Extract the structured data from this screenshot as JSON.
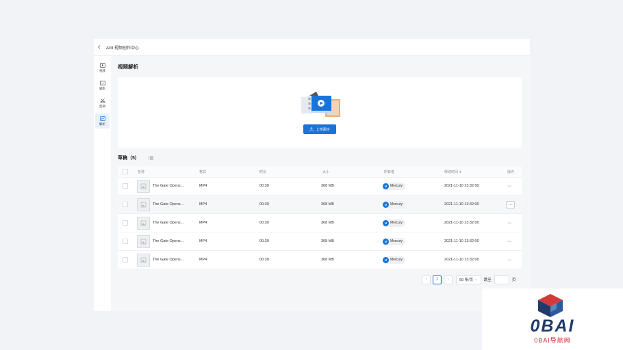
{
  "app": {
    "title": "AGI 视频创作中心"
  },
  "sidebar": {
    "items": [
      {
        "label": "视频",
        "icon": "video-icon"
      },
      {
        "label": "脚本",
        "icon": "script-icon"
      },
      {
        "label": "剪辑",
        "icon": "scissors-icon"
      },
      {
        "label": "解析",
        "icon": "analysis-icon",
        "active": true
      }
    ]
  },
  "page": {
    "title": "视频解析"
  },
  "upload": {
    "button_label": "上传素材"
  },
  "drafts": {
    "title": "草稿（5）"
  },
  "table": {
    "columns": [
      "名称",
      "格式",
      "时长",
      "大小",
      "所有者",
      "修改时间 ⇕",
      "操作"
    ],
    "rows": [
      {
        "name": "The Gate Opens...",
        "format": "MP4",
        "duration": "00:30",
        "size": "368 MB",
        "owner": "Mercury",
        "owner_initial": "M",
        "modified": "2021-11-10 13:32:00",
        "action": "···"
      },
      {
        "name": "The Gate Opens...",
        "format": "MP4",
        "duration": "00:30",
        "size": "368 MB",
        "owner": "Mercury",
        "owner_initial": "M",
        "modified": "2021-11-10 13:32:00",
        "action": "···"
      },
      {
        "name": "The Gate Opens...",
        "format": "MP4",
        "duration": "00:30",
        "size": "368 MB",
        "owner": "Mercury",
        "owner_initial": "M",
        "modified": "2021-11-10 13:32:00",
        "action": "···"
      },
      {
        "name": "The Gate Opens...",
        "format": "MP4",
        "duration": "00:30",
        "size": "368 MB",
        "owner": "Mercury",
        "owner_initial": "M",
        "modified": "2021-11-10 13:32:00",
        "action": "···"
      },
      {
        "name": "The Gate Opens...",
        "format": "MP4",
        "duration": "00:30",
        "size": "368 MB",
        "owner": "Mercury",
        "owner_initial": "M",
        "modified": "2021-11-10 13:32:00",
        "action": "···"
      }
    ]
  },
  "pagination": {
    "prev": "‹",
    "current_page": "1",
    "next": "›",
    "page_size": "50 条/页",
    "jump_label": "跳至",
    "page_unit": "页"
  },
  "watermark": {
    "title": "0BAI",
    "subtitle": "0BAI导航网"
  },
  "colors": {
    "accent": "#1a73d9",
    "background": "#f2f3f6",
    "watermark_blue": "#1f3a6b",
    "watermark_red": "#c22a2a"
  }
}
